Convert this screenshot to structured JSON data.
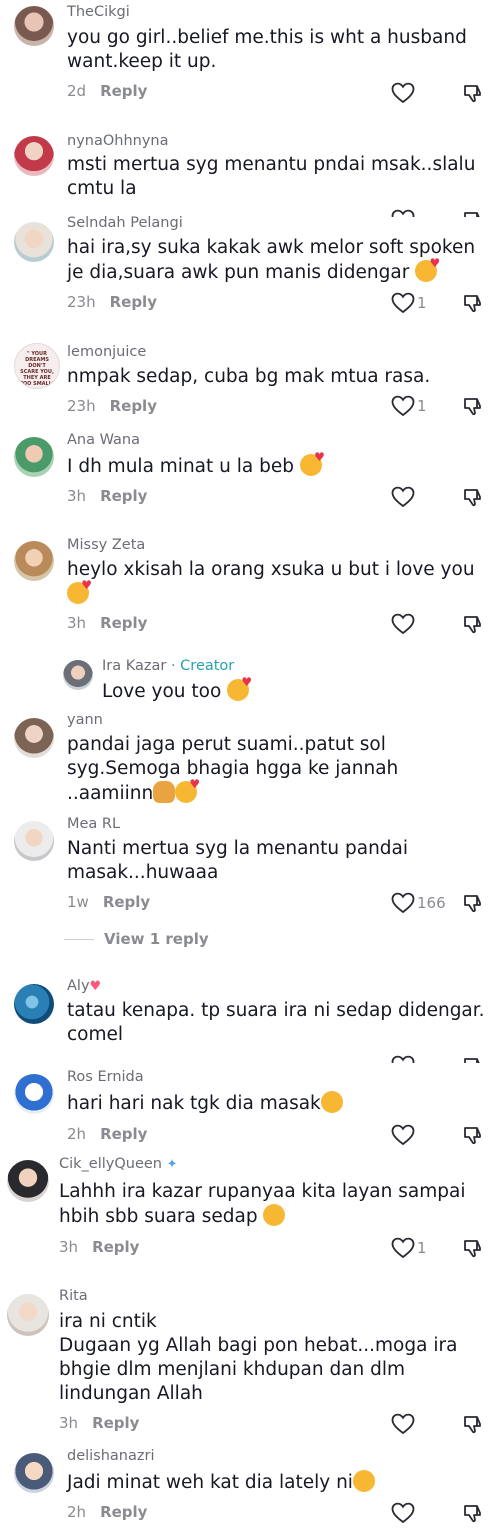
{
  "comments": [
    {
      "user": "TheCikgi",
      "text": "you go girl..belief me.this is wht a husband want.keep it up.",
      "time": "2d",
      "reply": "Reply",
      "likes": ""
    },
    {
      "user": "nynaOhhnyna",
      "text": "msti mertua syg menantu pndai msak..slalu cmtu la",
      "time": "",
      "reply": "",
      "likes": ""
    },
    {
      "user": "Selndah Pelangi",
      "text": "hai ira,sy suka kakak awk melor soft spoken je dia,suara awk pun manis didengar",
      "time": "23h",
      "reply": "Reply",
      "likes": "1"
    },
    {
      "user": "lemonjuice",
      "text": "nmpak sedap, cuba bg mak mtua rasa.",
      "time": "23h",
      "reply": "Reply",
      "likes": "1",
      "avatar_text": "\" YOUR DREAMS DON'T SCARE YOU, THEY ARE TOO SMALL\""
    },
    {
      "user": "Ana Wana",
      "text": "I dh mula minat u la beb",
      "time": "3h",
      "reply": "Reply",
      "likes": ""
    },
    {
      "user": "Missy Zeta",
      "text": "heylo xkisah la orang xsuka u but i love you",
      "time": "3h",
      "reply": "Reply",
      "likes": ""
    },
    {
      "user": "Ira Kazar",
      "creator": "· Creator",
      "text": "Love you too"
    },
    {
      "user": "yann",
      "text": "pandai jaga perut suami..patut sol syg.Semoga bhagia hgga ke jannah ..aamiinn"
    },
    {
      "user": "Mea RL",
      "text": "Nanti mertua syg la menantu pandai masak...huwaaa",
      "time": "1w",
      "reply": "Reply",
      "likes": "166",
      "view_replies": "View 1 reply"
    },
    {
      "user": "Aly",
      "text": "tatau kenapa. tp suara ira ni sedap didengar. comel"
    },
    {
      "user": "Ros Ernida",
      "text": "hari hari nak tgk dia masak",
      "time": "2h",
      "reply": "Reply",
      "likes": ""
    },
    {
      "user": "Cik_ellyQueen",
      "text": "Lahhh ira kazar rupanyaa kita layan sampai hbih sbb suara sedap",
      "time": "3h",
      "reply": "Reply",
      "likes": "1"
    },
    {
      "user": "Rita",
      "text": "ira ni cntik\nDugaan yg Allah bagi pon hebat...moga ira bhgie dlm menjlani khdupan dan dlm lindungan Allah",
      "time": "3h",
      "reply": "Reply",
      "likes": ""
    },
    {
      "user": "delishanazri",
      "text": "Jadi minat weh kat dia lately ni",
      "time": "2h",
      "reply": "Reply",
      "likes": ""
    }
  ],
  "icons": {
    "like": "heart-outline-icon",
    "dislike": "thumbs-down-outline-icon"
  },
  "colors": {
    "creator": "#25a2b3",
    "meta": "#8a8b91",
    "text": "#161823"
  }
}
